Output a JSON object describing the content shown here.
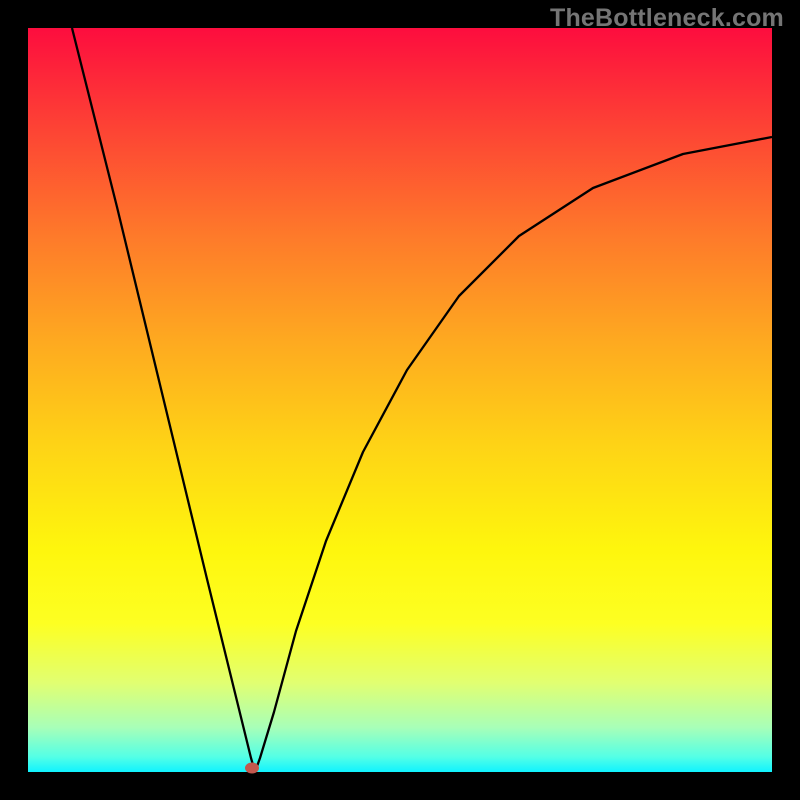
{
  "watermark": "TheBottleneck.com",
  "chart_data": {
    "type": "line",
    "title": "",
    "xlabel": "",
    "ylabel": "",
    "xlim": [
      0,
      1
    ],
    "ylim": [
      0,
      1
    ],
    "notes": "Gradient background from red (top) to cyan/green (bottom). Single V-shaped black curve: steep linear descent from top-left to a sharp minimum near x≈0.30 at y≈0, then a concave rise approaching y≈0.85 at the right edge. A small reddish marker sits at the curve's minimum.",
    "series": [
      {
        "name": "curve",
        "x": [
          0.06,
          0.12,
          0.18,
          0.24,
          0.3,
          0.305,
          0.312,
          0.33,
          0.36,
          0.4,
          0.45,
          0.51,
          0.58,
          0.66,
          0.76,
          0.88,
          1.0
        ],
        "y": [
          1.0,
          0.76,
          0.51,
          0.26,
          0.018,
          0.0,
          0.018,
          0.08,
          0.19,
          0.31,
          0.43,
          0.54,
          0.64,
          0.72,
          0.785,
          0.83,
          0.853
        ]
      }
    ],
    "marker": {
      "x": 0.301,
      "y": 0.005,
      "color": "#c2584e"
    },
    "colors": {
      "curve": "#000000",
      "frame": "#000000",
      "gradient_top": "#fd0d3e",
      "gradient_bottom": "#10f3ff"
    }
  }
}
